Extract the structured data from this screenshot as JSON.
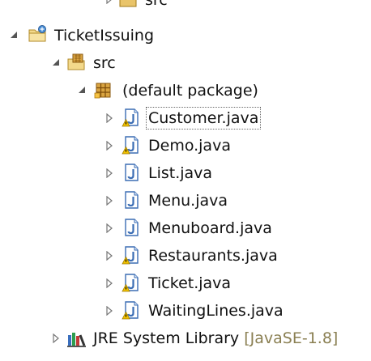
{
  "tree": {
    "top_partial_label": "src",
    "project": {
      "label": "TicketIssuing"
    },
    "src_folder": {
      "label": "src"
    },
    "package": {
      "label": "(default package)"
    },
    "files": [
      {
        "label": "Customer.java",
        "icon": "java-file-warning-icon"
      },
      {
        "label": "Demo.java",
        "icon": "java-file-warning-icon"
      },
      {
        "label": "List.java",
        "icon": "java-file-icon"
      },
      {
        "label": "Menu.java",
        "icon": "java-file-icon"
      },
      {
        "label": "Menuboard.java",
        "icon": "java-file-icon"
      },
      {
        "label": "Restaurants.java",
        "icon": "java-file-warning-icon"
      },
      {
        "label": "Ticket.java",
        "icon": "java-file-warning-icon"
      },
      {
        "label": "WaitingLines.java",
        "icon": "java-file-warning-icon"
      }
    ],
    "jre": {
      "label": "JRE System Library",
      "decoration": "[JavaSE-1.8]"
    }
  },
  "colors": {
    "selection_border": "#6a6a6a",
    "decoration_text": "#8a7f52",
    "twistie": "#555555",
    "java_icon_blue": "#3b6db4",
    "warning_yellow": "#e6b200"
  }
}
